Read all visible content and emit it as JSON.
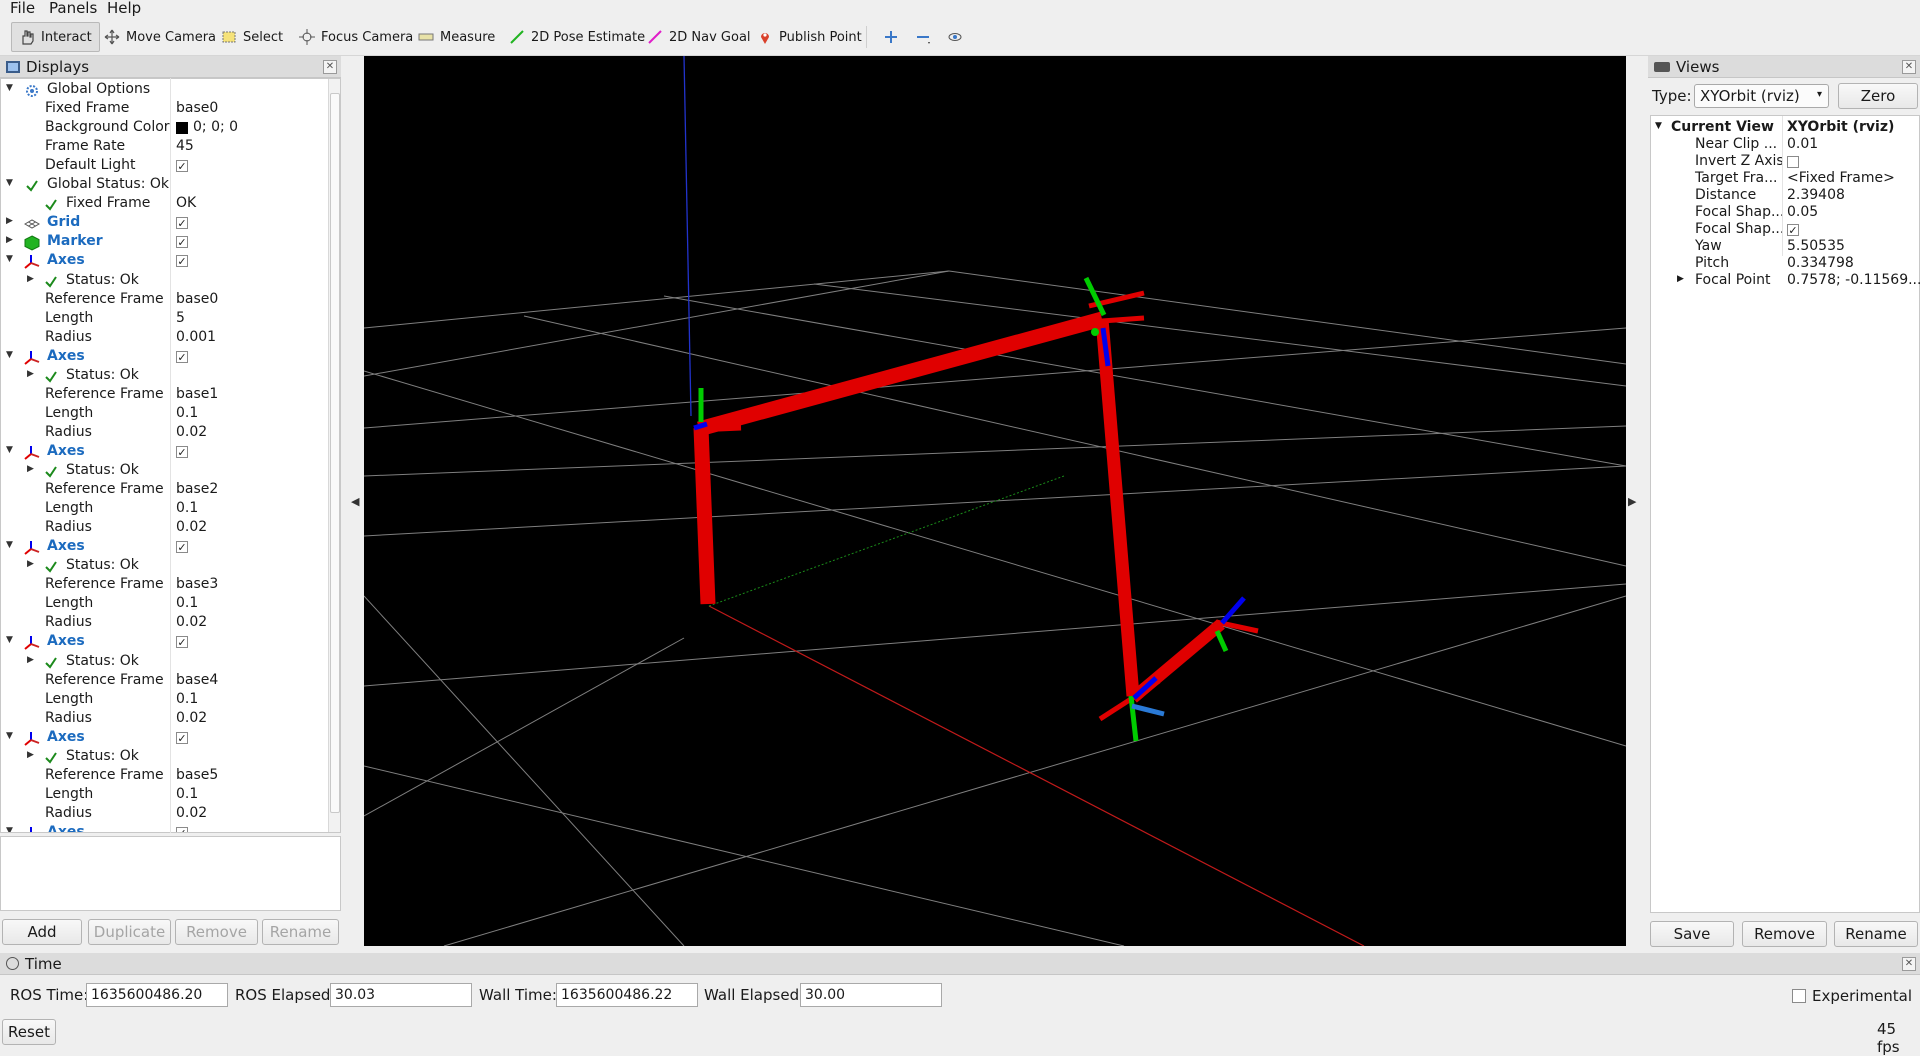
{
  "menu": {
    "file": "File",
    "panels": "Panels",
    "help": "Help"
  },
  "toolbar": {
    "interact": "Interact",
    "move_camera": "Move Camera",
    "select": "Select",
    "focus_camera": "Focus Camera",
    "measure": "Measure",
    "pose_estimate": "2D Pose Estimate",
    "nav_goal": "2D Nav Goal",
    "publish_point": "Publish Point"
  },
  "displays": {
    "title": "Displays",
    "rows": [
      {
        "label": "Global Options",
        "value": ""
      },
      {
        "label": "Fixed Frame",
        "value": "base0"
      },
      {
        "label": "Background Color",
        "value": "0; 0; 0"
      },
      {
        "label": "Frame Rate",
        "value": "45"
      },
      {
        "label": "Default Light",
        "value": "✓"
      },
      {
        "label": "Global Status: Ok",
        "value": ""
      },
      {
        "label": "Fixed Frame",
        "value": "OK"
      },
      {
        "label": "Grid",
        "value": "✓"
      },
      {
        "label": "Marker",
        "value": "✓"
      },
      {
        "label": "Axes",
        "value": "✓"
      },
      {
        "label": "Status: Ok",
        "value": ""
      },
      {
        "label": "Reference Frame",
        "value": "base0"
      },
      {
        "label": "Length",
        "value": "5"
      },
      {
        "label": "Radius",
        "value": "0.001"
      },
      {
        "label": "Axes",
        "value": "✓"
      },
      {
        "label": "Status: Ok",
        "value": ""
      },
      {
        "label": "Reference Frame",
        "value": "base1"
      },
      {
        "label": "Length",
        "value": "0.1"
      },
      {
        "label": "Radius",
        "value": "0.02"
      },
      {
        "label": "Axes",
        "value": "✓"
      },
      {
        "label": "Status: Ok",
        "value": ""
      },
      {
        "label": "Reference Frame",
        "value": "base2"
      },
      {
        "label": "Length",
        "value": "0.1"
      },
      {
        "label": "Radius",
        "value": "0.02"
      },
      {
        "label": "Axes",
        "value": "✓"
      },
      {
        "label": "Status: Ok",
        "value": ""
      },
      {
        "label": "Reference Frame",
        "value": "base3"
      },
      {
        "label": "Length",
        "value": "0.1"
      },
      {
        "label": "Radius",
        "value": "0.02"
      },
      {
        "label": "Axes",
        "value": "✓"
      },
      {
        "label": "Status: Ok",
        "value": ""
      },
      {
        "label": "Reference Frame",
        "value": "base4"
      },
      {
        "label": "Length",
        "value": "0.1"
      },
      {
        "label": "Radius",
        "value": "0.02"
      },
      {
        "label": "Axes",
        "value": "✓"
      },
      {
        "label": "Status: Ok",
        "value": ""
      },
      {
        "label": "Reference Frame",
        "value": "base5"
      },
      {
        "label": "Length",
        "value": "0.1"
      },
      {
        "label": "Radius",
        "value": "0.02"
      },
      {
        "label": "Axes",
        "value": "✓"
      }
    ],
    "buttons": {
      "add": "Add",
      "duplicate": "Duplicate",
      "remove": "Remove",
      "rename": "Rename"
    }
  },
  "views": {
    "title": "Views",
    "type_label": "Type:",
    "type_value": "XYOrbit (rviz)",
    "zero": "Zero",
    "current_view_label": "Current View",
    "current_view_value": "XYOrbit (rviz)",
    "props": [
      {
        "label": "Near Clip ...",
        "value": "0.01"
      },
      {
        "label": "Invert Z Axis",
        "value": ""
      },
      {
        "label": "Target Fra...",
        "value": "<Fixed Frame>"
      },
      {
        "label": "Distance",
        "value": "2.39408"
      },
      {
        "label": "Focal Shap...",
        "value": "0.05"
      },
      {
        "label": "Focal Shap...",
        "value": "✓"
      },
      {
        "label": "Yaw",
        "value": "5.50535"
      },
      {
        "label": "Pitch",
        "value": "0.334798"
      },
      {
        "label": "Focal Point",
        "value": "0.7578; -0.11569..."
      }
    ],
    "buttons": {
      "save": "Save",
      "remove": "Remove",
      "rename": "Rename"
    }
  },
  "time": {
    "title": "Time",
    "ros_time_label": "ROS Time:",
    "ros_time": "1635600486.20",
    "ros_elapsed_label": "ROS Elapsed:",
    "ros_elapsed": "30.03",
    "wall_time_label": "Wall Time:",
    "wall_time": "1635600486.22",
    "wall_elapsed_label": "Wall Elapsed:",
    "wall_elapsed": "30.00",
    "experimental": "Experimental",
    "reset": "Reset",
    "fps": "45 fps"
  },
  "colors": {
    "link_red": "#e00000",
    "axis_green": "#00cc00",
    "axis_blue": "#0000ee",
    "grid": "#8a8a8a",
    "tree_blue": "#1c6bbf"
  }
}
